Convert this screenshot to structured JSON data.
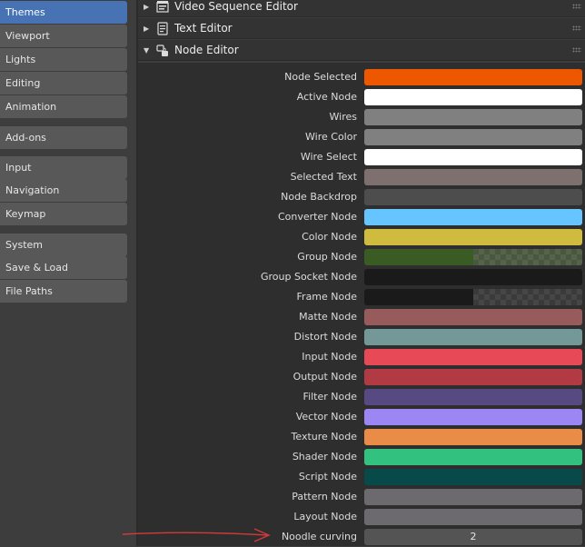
{
  "sidebar": {
    "items": [
      {
        "label": "Themes",
        "active": true
      },
      {
        "label": "Viewport"
      },
      {
        "label": "Lights"
      },
      {
        "label": "Editing"
      },
      {
        "label": "Animation"
      },
      {
        "label": "Add-ons"
      },
      {
        "label": "Input"
      },
      {
        "label": "Navigation"
      },
      {
        "label": "Keymap"
      },
      {
        "label": "System"
      },
      {
        "label": "Save & Load"
      },
      {
        "label": "File Paths"
      }
    ]
  },
  "sections": [
    {
      "title": "Video Sequence Editor",
      "expanded": false,
      "icon": "video-sequencer-icon"
    },
    {
      "title": "Text Editor",
      "expanded": false,
      "icon": "text-editor-icon"
    },
    {
      "title": "Node Editor",
      "expanded": true,
      "icon": "node-editor-icon"
    }
  ],
  "node_editor": {
    "colors": [
      {
        "label": "Node Selected",
        "color": "#ed5700"
      },
      {
        "label": "Active Node",
        "color": "#ffffff"
      },
      {
        "label": "Wires",
        "color": "#808080"
      },
      {
        "label": "Wire Color",
        "color": "#808080"
      },
      {
        "label": "Wire Select",
        "color": "#ffffff"
      },
      {
        "label": "Selected Text",
        "color": "#7f7070"
      },
      {
        "label": "Node Backdrop",
        "color": "#4d4d4d"
      },
      {
        "label": "Converter Node",
        "color": "#66c4ff"
      },
      {
        "label": "Color Node",
        "color": "#cfbc3e"
      },
      {
        "label": "Group Node",
        "color": "#3b5b24",
        "alpha": true
      },
      {
        "label": "Group Socket Node",
        "color": "#1a1a1a"
      },
      {
        "label": "Frame Node",
        "color": "#1a1a1a",
        "alpha": true
      },
      {
        "label": "Matte Node",
        "color": "#975b5b"
      },
      {
        "label": "Distort Node",
        "color": "#749797"
      },
      {
        "label": "Input Node",
        "color": "#e84957"
      },
      {
        "label": "Output Node",
        "color": "#b13a45"
      },
      {
        "label": "Filter Node",
        "color": "#574a83"
      },
      {
        "label": "Vector Node",
        "color": "#9b86f4"
      },
      {
        "label": "Texture Node",
        "color": "#e88c47"
      },
      {
        "label": "Shader Node",
        "color": "#33c17f"
      },
      {
        "label": "Script Node",
        "color": "#084a4a"
      },
      {
        "label": "Pattern Node",
        "color": "#6c696f"
      },
      {
        "label": "Layout Node",
        "color": "#6c696f"
      }
    ],
    "noodle_curving": {
      "label": "Noodle curving",
      "value": "2"
    }
  },
  "annotation": {
    "color": "#d23a3a"
  }
}
